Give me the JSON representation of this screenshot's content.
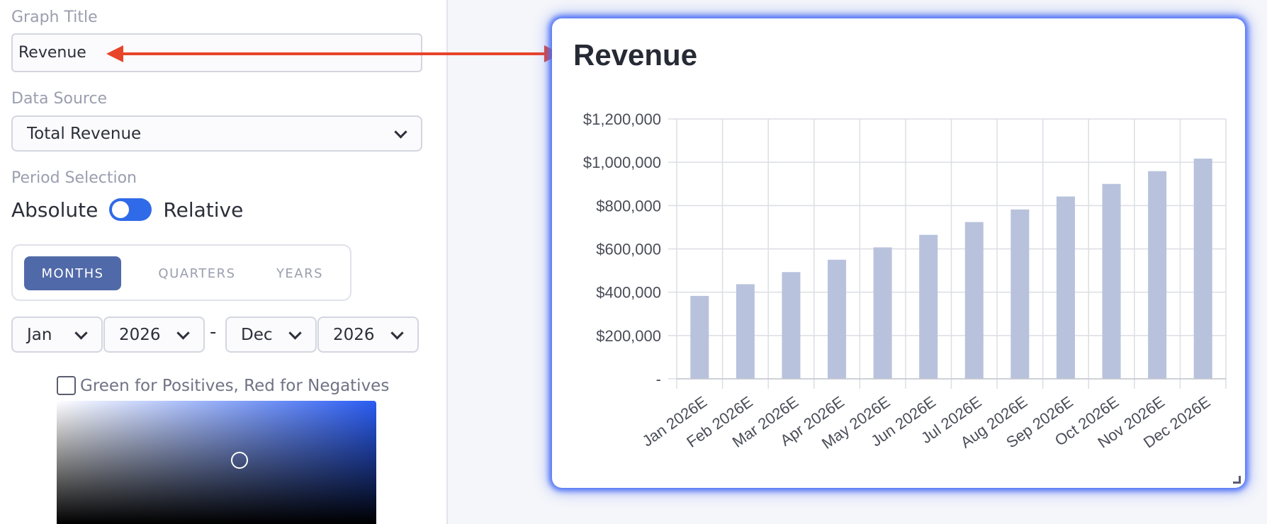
{
  "form": {
    "graph_title_label": "Graph Title",
    "graph_title_value": "Revenue",
    "data_source_label": "Data Source",
    "data_source_value": "Total Revenue",
    "period_selection_label": "Period Selection",
    "toggle_left": "Absolute",
    "toggle_right": "Relative",
    "period_tabs": [
      {
        "label": "MONTHS",
        "active": true
      },
      {
        "label": "QUARTERS",
        "active": false
      },
      {
        "label": "YEARS",
        "active": false
      }
    ],
    "start_month": "Jan",
    "start_year": "2026",
    "range_separator": "-",
    "end_month": "Dec",
    "end_year": "2026",
    "checkbox_label": "Green for Positives, Red for Negatives",
    "checkbox_checked": false,
    "picker_colors": {
      "hue": "#2a5cf2",
      "white": "#ffffff",
      "black": "#000000"
    }
  },
  "colors": {
    "accent": "#2f6ae8",
    "active_tab": "#5069a8",
    "bar": "#b8c2dc",
    "arrow": "#e8442a",
    "card_glow": "#4c6ff5"
  },
  "chart_data": {
    "type": "bar",
    "title": "Revenue",
    "categories": [
      "Jan 2026E",
      "Feb 2026E",
      "Mar 2026E",
      "Apr 2026E",
      "May 2026E",
      "Jun 2026E",
      "Jul 2026E",
      "Aug 2026E",
      "Sep 2026E",
      "Oct 2026E",
      "Nov 2026E",
      "Dec 2026E"
    ],
    "values": [
      383000,
      437000,
      493000,
      550000,
      607000,
      665000,
      724000,
      782000,
      842000,
      900000,
      959000,
      1017000
    ],
    "ylim": [
      0,
      1200000
    ],
    "yticks": [
      0,
      200000,
      400000,
      600000,
      800000,
      1000000,
      1200000
    ],
    "ytick_labels": [
      "-",
      "$200,000",
      "$400,000",
      "$600,000",
      "$800,000",
      "$1,000,000",
      "$1,200,000"
    ],
    "grid": true,
    "legend": "none"
  }
}
